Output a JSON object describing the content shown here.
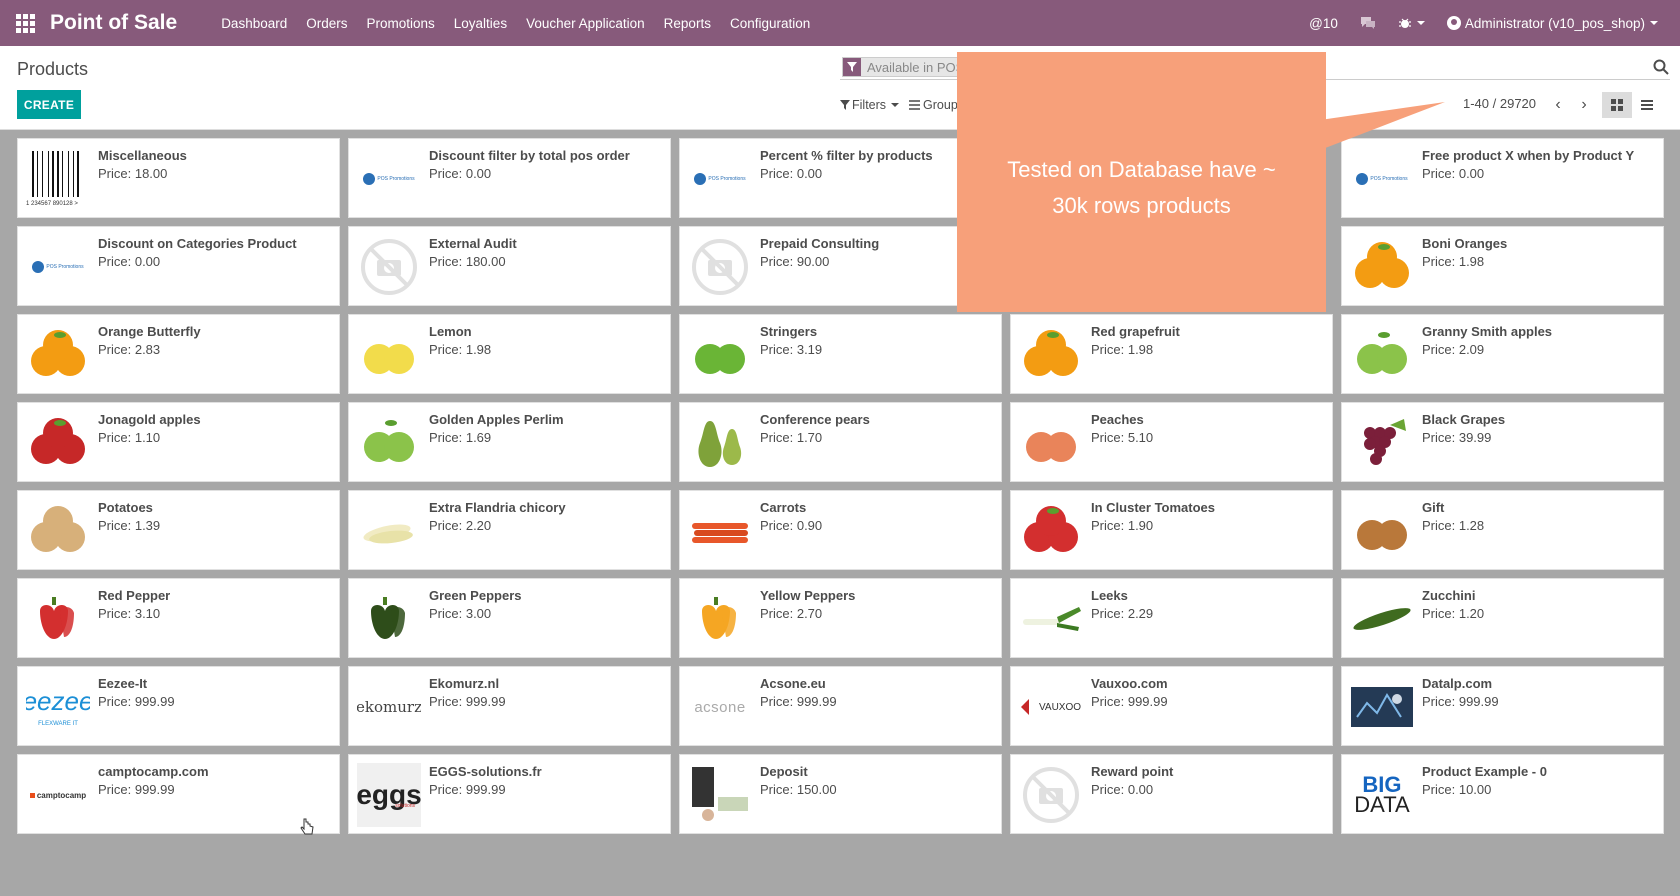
{
  "navbar": {
    "app_title": "Point of Sale",
    "menu": [
      "Dashboard",
      "Orders",
      "Promotions",
      "Loyalties",
      "Voucher Application",
      "Reports",
      "Configuration"
    ],
    "messages_count": "10",
    "user": "Administrator (v10_pos_shop)"
  },
  "control_panel": {
    "breadcrumb": "Products",
    "create_label": "CREATE",
    "facet": "Available in POS",
    "filters_label": "Filters",
    "group_label": "Group",
    "pager": "1-40 / 29720"
  },
  "callout": {
    "text": "Tested on Database have ~ 30k rows products"
  },
  "products": [
    {
      "name": "Miscellaneous",
      "price": "Price: 18.00",
      "icon": "barcode-icon"
    },
    {
      "name": "Discount filter by total pos order",
      "price": "Price: 0.00",
      "icon": "pos-promotions-logo"
    },
    {
      "name": "Percent % filter by products",
      "price": "Price: 0.00",
      "icon": "pos-promotions-logo"
    },
    {
      "name": "",
      "price": "",
      "icon": ""
    },
    {
      "name": "Free product X when by Product Y",
      "price": "Price: 0.00",
      "icon": "pos-promotions-logo"
    },
    {
      "name": "Discount on Categories Product",
      "price": "Price: 0.00",
      "icon": "pos-promotions-logo"
    },
    {
      "name": "External Audit",
      "price": "Price: 180.00",
      "icon": "no-image-icon"
    },
    {
      "name": "Prepaid Consulting",
      "price": "Price: 90.00",
      "icon": "no-image-icon"
    },
    {
      "name": "",
      "price": "",
      "icon": ""
    },
    {
      "name": "Boni Oranges",
      "price": "Price: 1.98",
      "icon": "orange-icon"
    },
    {
      "name": "Orange Butterfly",
      "price": "Price: 2.83",
      "icon": "orange-icon"
    },
    {
      "name": "Lemon",
      "price": "Price: 1.98",
      "icon": "lemon-icon"
    },
    {
      "name": "Stringers",
      "price": "Price: 3.19",
      "icon": "lime-icon"
    },
    {
      "name": "Red grapefruit",
      "price": "Price: 1.98",
      "icon": "orange-icon"
    },
    {
      "name": "Granny Smith apples",
      "price": "Price: 2.09",
      "icon": "green-apple-icon"
    },
    {
      "name": "Jonagold apples",
      "price": "Price: 1.10",
      "icon": "red-apple-icon"
    },
    {
      "name": "Golden Apples Perlim",
      "price": "Price: 1.69",
      "icon": "green-apple-icon"
    },
    {
      "name": "Conference pears",
      "price": "Price: 1.70",
      "icon": "pear-icon"
    },
    {
      "name": "Peaches",
      "price": "Price: 5.10",
      "icon": "peach-icon"
    },
    {
      "name": "Black Grapes",
      "price": "Price: 39.99",
      "icon": "grapes-icon"
    },
    {
      "name": "Potatoes",
      "price": "Price: 1.39",
      "icon": "potato-icon"
    },
    {
      "name": "Extra Flandria chicory",
      "price": "Price: 2.20",
      "icon": "chicory-icon"
    },
    {
      "name": "Carrots",
      "price": "Price: 0.90",
      "icon": "carrot-icon"
    },
    {
      "name": "In Cluster Tomatoes",
      "price": "Price: 1.90",
      "icon": "tomato-icon"
    },
    {
      "name": "Gift",
      "price": "Price: 1.28",
      "icon": "onion-icon"
    },
    {
      "name": "Red Pepper",
      "price": "Price: 3.10",
      "icon": "red-pepper-icon"
    },
    {
      "name": "Green Peppers",
      "price": "Price: 3.00",
      "icon": "green-pepper-icon"
    },
    {
      "name": "Yellow Peppers",
      "price": "Price: 2.70",
      "icon": "yellow-pepper-icon"
    },
    {
      "name": "Leeks",
      "price": "Price: 2.29",
      "icon": "leek-icon"
    },
    {
      "name": "Zucchini",
      "price": "Price: 1.20",
      "icon": "zucchini-icon"
    },
    {
      "name": "Eezee-It",
      "price": "Price: 999.99",
      "icon": "eezee-logo"
    },
    {
      "name": "Ekomurz.nl",
      "price": "Price: 999.99",
      "icon": "ekomurz-logo"
    },
    {
      "name": "Acsone.eu",
      "price": "Price: 999.99",
      "icon": "acsone-logo"
    },
    {
      "name": "Vauxoo.com",
      "price": "Price: 999.99",
      "icon": "vauxoo-logo"
    },
    {
      "name": "Datalp.com",
      "price": "Price: 999.99",
      "icon": "datalp-logo"
    },
    {
      "name": "camptocamp.com",
      "price": "Price: 999.99",
      "icon": "camptocamp-logo"
    },
    {
      "name": "EGGS-solutions.fr",
      "price": "Price: 999.99",
      "icon": "eggs-logo"
    },
    {
      "name": "Deposit",
      "price": "Price: 150.00",
      "icon": "deposit-icon"
    },
    {
      "name": "Reward point",
      "price": "Price: 0.00",
      "icon": "no-image-icon"
    },
    {
      "name": "Product Example - 0",
      "price": "Price: 10.00",
      "icon": "bigdata-logo"
    }
  ],
  "logos": {
    "pos_promotions": "POS Promotions",
    "eezee": "eezee",
    "eezee_sub": "FLEXWARE IT",
    "ekomurz": "ekomurz",
    "acsone": "acsone",
    "vauxoo": "VAUXOO",
    "camptocamp": "camptocamp",
    "eggs": "eggs",
    "eggs_sub": "solutions",
    "bigdata_1": "BIG",
    "bigdata_2": "DATA",
    "barcode_digits": "1 234567 890128 >"
  }
}
